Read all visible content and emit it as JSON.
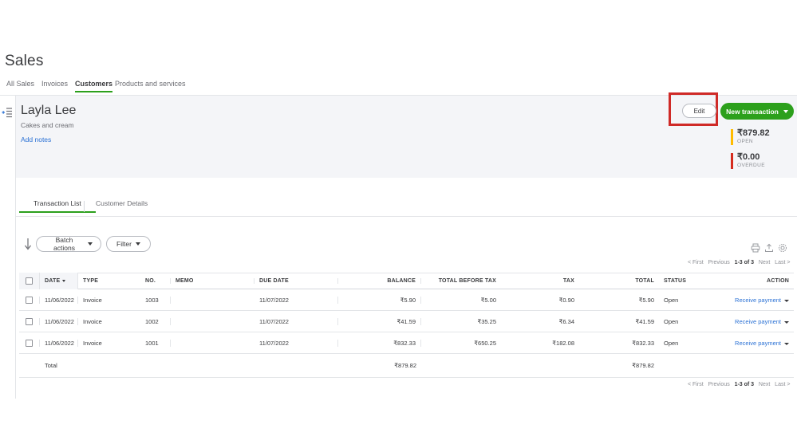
{
  "page": {
    "title": "Sales"
  },
  "topnav": {
    "items": [
      {
        "label": "All Sales",
        "active": false
      },
      {
        "label": "Invoices",
        "active": false
      },
      {
        "label": "Customers",
        "active": true
      },
      {
        "label": "Products and services",
        "active": false
      }
    ]
  },
  "customer": {
    "name": "Layla Lee",
    "subtitle": "Cakes and cream",
    "notes_link": "Add notes",
    "edit_label": "Edit",
    "new_transaction_label": "New transaction",
    "balances": [
      {
        "amount": "₹879.82",
        "label": "OPEN",
        "color": "#ffbb00"
      },
      {
        "amount": "₹0.00",
        "label": "OVERDUE",
        "color": "#d52b1e"
      }
    ]
  },
  "section_tabs": [
    {
      "label": "Transaction List",
      "active": true
    },
    {
      "label": "Customer Details",
      "active": false
    }
  ],
  "toolbar": {
    "batch_actions_label": "Batch actions",
    "filter_label": "Filter",
    "icons": [
      "print-icon",
      "export-icon",
      "settings-icon"
    ]
  },
  "pagination": {
    "first": "< First",
    "previous": "Previous",
    "range": "1-3 of 3",
    "next": "Next",
    "last": "Last >"
  },
  "table": {
    "columns": [
      "DATE",
      "TYPE",
      "NO.",
      "MEMO",
      "DUE DATE",
      "BALANCE",
      "TOTAL BEFORE TAX",
      "TAX",
      "TOTAL",
      "STATUS",
      "ACTION"
    ],
    "sorted_column": "DATE",
    "action_label": "Receive payment",
    "rows": [
      {
        "date": "11/06/2022",
        "type": "Invoice",
        "no": "1003",
        "memo": "",
        "due_date": "11/07/2022",
        "balance": "₹5.90",
        "total_before_tax": "₹5.00",
        "tax": "₹0.90",
        "total": "₹5.90",
        "status": "Open",
        "action": "Receive payment"
      },
      {
        "date": "11/06/2022",
        "type": "Invoice",
        "no": "1002",
        "memo": "",
        "due_date": "11/07/2022",
        "balance": "₹41.59",
        "total_before_tax": "₹35.25",
        "tax": "₹6.34",
        "total": "₹41.59",
        "status": "Open",
        "action": "Receive payment"
      },
      {
        "date": "11/06/2022",
        "type": "Invoice",
        "no": "1001",
        "memo": "",
        "due_date": "11/07/2022",
        "balance": "₹832.33",
        "total_before_tax": "₹650.25",
        "tax": "₹182.08",
        "total": "₹832.33",
        "status": "Open",
        "action": "Receive payment"
      }
    ],
    "total_row": {
      "label": "Total",
      "balance": "₹879.82",
      "total": "₹879.82"
    }
  },
  "colors": {
    "brand_green": "#2ca01c",
    "link_blue": "#2c72d5",
    "annotation_red": "#cf2a27",
    "band_gray": "#f4f5f8"
  }
}
